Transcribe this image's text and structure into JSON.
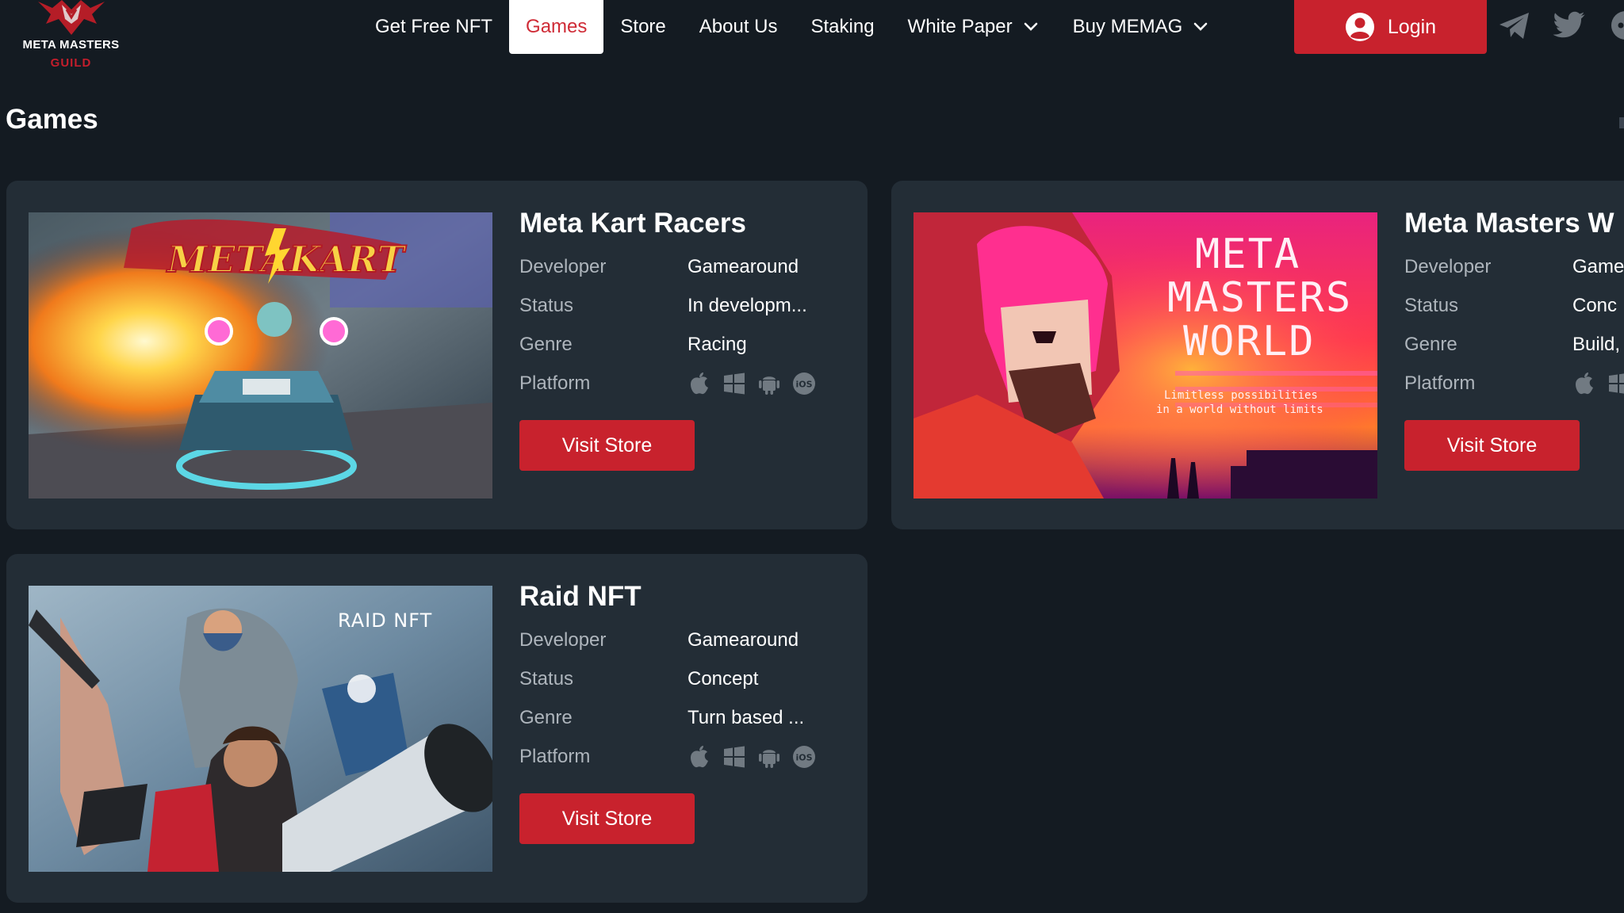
{
  "brand": {
    "logo_line1": "META MASTERS",
    "logo_line2": "GUILD",
    "accent_color": "#c8222d"
  },
  "nav": {
    "items": [
      {
        "label": "Get Free NFT"
      },
      {
        "label": "Games",
        "active": true
      },
      {
        "label": "Store"
      },
      {
        "label": "About Us"
      },
      {
        "label": "Staking"
      },
      {
        "label": "White Paper",
        "dropdown": true
      },
      {
        "label": "Buy MEMAG",
        "dropdown": true
      }
    ],
    "login_label": "Login",
    "login_icon": "user-circle-icon",
    "social_icons": [
      "telegram-icon",
      "twitter-icon",
      "discord-icon"
    ]
  },
  "page": {
    "title": "Games"
  },
  "labels": {
    "developer": "Developer",
    "status": "Status",
    "genre": "Genre",
    "platform": "Platform",
    "visit_store": "Visit Store"
  },
  "games": [
    {
      "title": "Meta Kart Racers",
      "developer": "Gamearound",
      "status": "In developm...",
      "genre": "Racing",
      "platforms": [
        "apple-icon",
        "windows-icon",
        "android-icon",
        "ios-icon"
      ],
      "image_text": "METAKART"
    },
    {
      "title": "Meta Masters W",
      "developer": "Game",
      "status": "Conc",
      "genre": "Build,",
      "platforms": [
        "apple-icon",
        "windows-icon"
      ],
      "image_text_1": "META",
      "image_text_2": "MASTERS",
      "image_text_3": "WORLD",
      "image_tagline_1": "Limitless possibilities",
      "image_tagline_2": "in a world without limits"
    },
    {
      "title": "Raid NFT",
      "developer": "Gamearound",
      "status": "Concept",
      "genre": "Turn based ...",
      "platforms": [
        "apple-icon",
        "windows-icon",
        "android-icon",
        "ios-icon"
      ],
      "image_text": "RAID NFT"
    }
  ]
}
